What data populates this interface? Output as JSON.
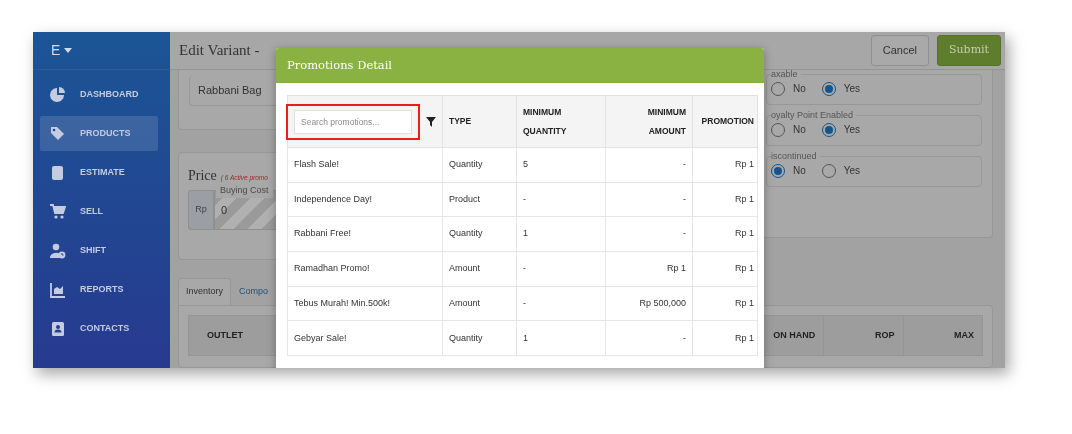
{
  "sidebar": {
    "brand": "E",
    "items": [
      {
        "label": "DASHBOARD",
        "selected": false
      },
      {
        "label": "PRODUCTS",
        "selected": true
      },
      {
        "label": "ESTIMATE",
        "selected": false
      },
      {
        "label": "SELL",
        "selected": false
      },
      {
        "label": "SHIFT",
        "selected": false
      },
      {
        "label": "REPORTS",
        "selected": false
      },
      {
        "label": "CONTACTS",
        "selected": false
      }
    ]
  },
  "header": {
    "title": "Edit Variant -",
    "buttons": [
      {
        "label": "Cancel",
        "kind": "secondary"
      },
      {
        "label": "Submit",
        "kind": "primary"
      }
    ]
  },
  "general_card": {
    "name_value": "Rabbani Bag"
  },
  "price_card": {
    "title": "Price",
    "note": "( 6 Active promo",
    "buying_cost": {
      "label": "Buying Cost",
      "prefix": "Rp",
      "value": "0"
    }
  },
  "options": [
    {
      "legend": "axable",
      "choices": [
        {
          "label": "No",
          "selected": false
        },
        {
          "label": "Yes",
          "selected": true
        }
      ]
    },
    {
      "legend": "oyalty Point Enabled",
      "choices": [
        {
          "label": "No",
          "selected": false
        },
        {
          "label": "Yes",
          "selected": true
        }
      ]
    },
    {
      "legend": "iscontinued",
      "choices": [
        {
          "label": "No",
          "selected": true
        },
        {
          "label": "Yes",
          "selected": false
        }
      ]
    }
  ],
  "tabs": [
    {
      "label": "Inventory",
      "selected": true
    },
    {
      "label": "Compo",
      "selected": false
    }
  ],
  "inventory_table": {
    "columns": [
      "OUTLET",
      "ON HAND",
      "ROP",
      "MAX"
    ]
  },
  "modal": {
    "title": "Promotions Detail",
    "columns": [
      {
        "kind": "search",
        "placeholder": "Search promotions...",
        "highlighted": true
      },
      {
        "kind": "label",
        "label": "TYPE"
      },
      {
        "kind": "label",
        "label": "MINIMUM QUANTITY"
      },
      {
        "kind": "label",
        "label": "MINIMUM AMOUNT"
      },
      {
        "kind": "label",
        "label": "PROMOTION"
      }
    ],
    "rows": [
      [
        "Flash Sale!",
        "Quantity",
        "5",
        "-",
        "Rp 1"
      ],
      [
        "Independence Day!",
        "Product",
        "-",
        "-",
        "Rp 1"
      ],
      [
        "Rabbani Free!",
        "Quantity",
        "1",
        "-",
        "Rp 1"
      ],
      [
        "Ramadhan Promo!",
        "Amount",
        "-",
        "Rp 1",
        "Rp 1"
      ],
      [
        "Tebus Murah! Min.500k!",
        "Amount",
        "-",
        "Rp 500,000",
        "Rp 1"
      ],
      [
        "Gebyar Sale!",
        "Quantity",
        "1",
        "-",
        "Rp 1"
      ]
    ]
  }
}
